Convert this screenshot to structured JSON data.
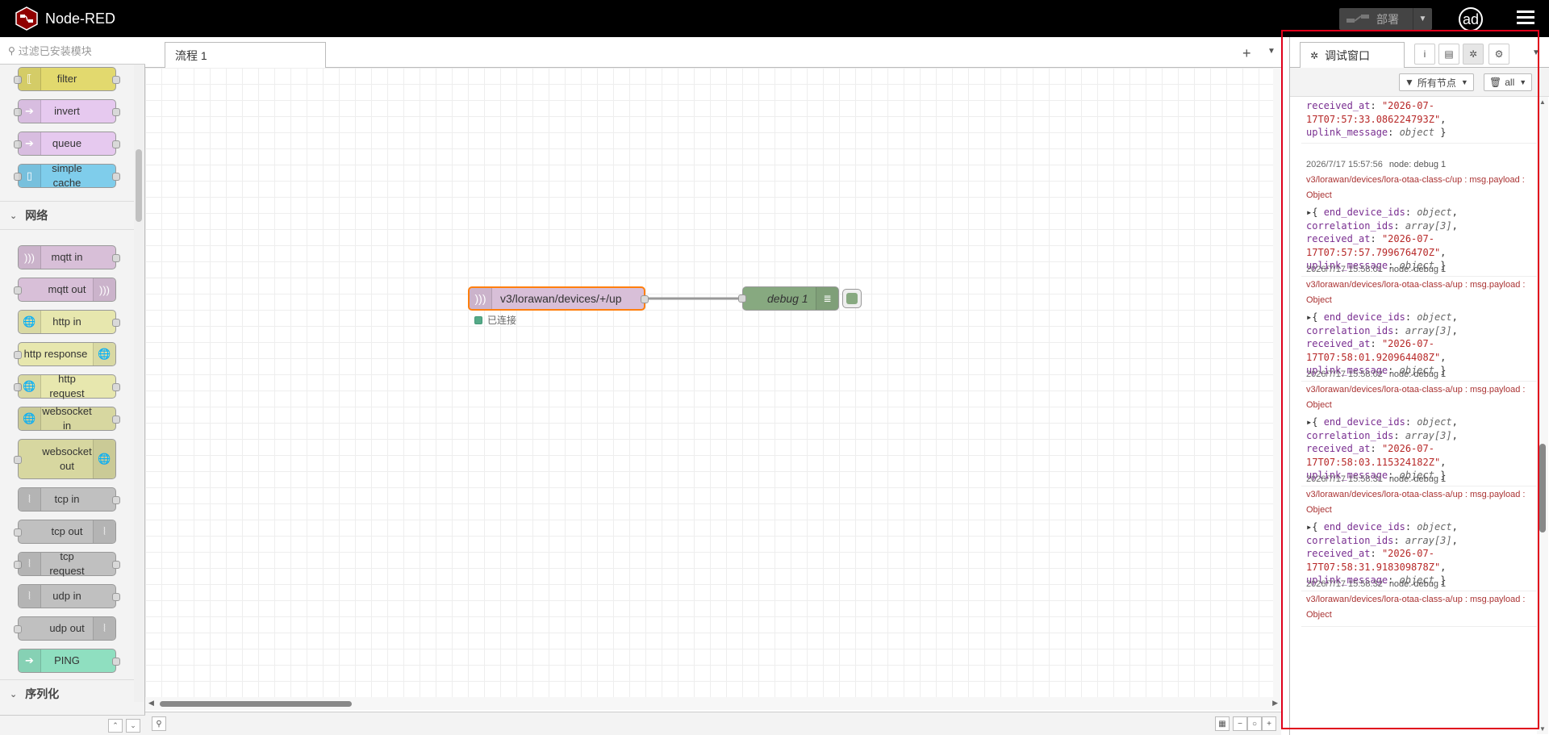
{
  "header": {
    "app_title": "Node-RED",
    "deploy_label": "部署",
    "user_initials": "ad"
  },
  "palette": {
    "search_placeholder": "过滤已安装模块",
    "nodes_top": [
      {
        "label": "filter",
        "color": "#e2d96e"
      },
      {
        "label": "invert",
        "color": "#e6c9ef"
      },
      {
        "label": "queue",
        "color": "#e6c9ef"
      },
      {
        "label": "simple cache",
        "color": "#7fcdeb"
      }
    ],
    "category_network": "网络",
    "nodes_network": [
      {
        "label": "mqtt in",
        "color": "#d8bfd8"
      },
      {
        "label": "mqtt out",
        "color": "#d8bfd8"
      },
      {
        "label": "http in",
        "color": "#e7e7ae"
      },
      {
        "label": "http response",
        "color": "#e7e7ae"
      },
      {
        "label": "http request",
        "color": "#e7e7ae"
      },
      {
        "label": "websocket in",
        "color": "#d7d7a0"
      },
      {
        "label": "websocket out",
        "color": "#d7d7a0"
      },
      {
        "label": "tcp in",
        "color": "#c0c0c0"
      },
      {
        "label": "tcp out",
        "color": "#c0c0c0"
      },
      {
        "label": "tcp request",
        "color": "#c0c0c0"
      },
      {
        "label": "udp in",
        "color": "#c0c0c0"
      },
      {
        "label": "udp out",
        "color": "#c0c0c0"
      },
      {
        "label": "PING",
        "color": "#8fdfc0"
      }
    ],
    "category_serialize": "序列化"
  },
  "workspace": {
    "tab_label": "流程 1",
    "mqtt_node_label": "v3/lorawan/devices/+/up",
    "mqtt_status": "已连接",
    "debug_node_label": "debug 1",
    "colors": {
      "mqtt": "#d8bfd8",
      "debug": "#87a980",
      "selected": "#ff7f0e",
      "status_ok": "#5a8"
    }
  },
  "sidebar": {
    "tab_label": "调试窗口",
    "filter_label": "所有节点",
    "clear_label": "all",
    "messages": [
      {
        "partial": true,
        "payload_lines": [
          [
            {
              "k": "received_at"
            },
            {
              "p": ": "
            },
            {
              "s": "\"2026-07-"
            }
          ],
          [
            {
              "s": "17T07:57:33.086224793Z\""
            },
            {
              "p": ","
            }
          ],
          [
            {
              "k": "uplink_message"
            },
            {
              "p": ": "
            },
            {
              "t": "object"
            },
            {
              "p": " }"
            }
          ]
        ]
      },
      {
        "time": "2026/7/17 15:57:56",
        "node": "node: debug 1",
        "topic": "v3/lorawan/devices/lora-otaa-class-c/up : msg.payload : Object",
        "payload_lines": [
          [
            {
              "p": "▸{ "
            },
            {
              "k": "end_device_ids"
            },
            {
              "p": ": "
            },
            {
              "t": "object"
            },
            {
              "p": ","
            }
          ],
          [
            {
              "k": "correlation_ids"
            },
            {
              "p": ": "
            },
            {
              "t": "array[3]"
            },
            {
              "p": ","
            }
          ],
          [
            {
              "k": "received_at"
            },
            {
              "p": ": "
            },
            {
              "s": "\"2026-07-"
            }
          ],
          [
            {
              "s": "17T07:57:57.799676470Z\""
            },
            {
              "p": ","
            }
          ],
          [
            {
              "k": "uplink_message"
            },
            {
              "p": ": "
            },
            {
              "t": "object"
            },
            {
              "p": " }"
            }
          ]
        ]
      },
      {
        "time": "2026/7/17 15:58:01",
        "node": "node: debug 1",
        "topic": "v3/lorawan/devices/lora-otaa-class-a/up : msg.payload : Object",
        "payload_lines": [
          [
            {
              "p": "▸{ "
            },
            {
              "k": "end_device_ids"
            },
            {
              "p": ": "
            },
            {
              "t": "object"
            },
            {
              "p": ","
            }
          ],
          [
            {
              "k": "correlation_ids"
            },
            {
              "p": ": "
            },
            {
              "t": "array[3]"
            },
            {
              "p": ","
            }
          ],
          [
            {
              "k": "received_at"
            },
            {
              "p": ": "
            },
            {
              "s": "\"2026-07-"
            }
          ],
          [
            {
              "s": "17T07:58:01.920964408Z\""
            },
            {
              "p": ","
            }
          ],
          [
            {
              "k": "uplink_message"
            },
            {
              "p": ": "
            },
            {
              "t": "object"
            },
            {
              "p": " }"
            }
          ]
        ]
      },
      {
        "time": "2026/7/17 15:58:02",
        "node": "node: debug 1",
        "topic": "v3/lorawan/devices/lora-otaa-class-a/up : msg.payload : Object",
        "payload_lines": [
          [
            {
              "p": "▸{ "
            },
            {
              "k": "end_device_ids"
            },
            {
              "p": ": "
            },
            {
              "t": "object"
            },
            {
              "p": ","
            }
          ],
          [
            {
              "k": "correlation_ids"
            },
            {
              "p": ": "
            },
            {
              "t": "array[3]"
            },
            {
              "p": ","
            }
          ],
          [
            {
              "k": "received_at"
            },
            {
              "p": ": "
            },
            {
              "s": "\"2026-07-"
            }
          ],
          [
            {
              "s": "17T07:58:03.115324182Z\""
            },
            {
              "p": ","
            }
          ],
          [
            {
              "k": "uplink_message"
            },
            {
              "p": ": "
            },
            {
              "t": "object"
            },
            {
              "p": " }"
            }
          ]
        ]
      },
      {
        "time": "2026/7/17 15:58:31",
        "node": "node: debug 1",
        "topic": "v3/lorawan/devices/lora-otaa-class-a/up : msg.payload : Object",
        "payload_lines": [
          [
            {
              "p": "▸{ "
            },
            {
              "k": "end_device_ids"
            },
            {
              "p": ": "
            },
            {
              "t": "object"
            },
            {
              "p": ","
            }
          ],
          [
            {
              "k": "correlation_ids"
            },
            {
              "p": ": "
            },
            {
              "t": "array[3]"
            },
            {
              "p": ","
            }
          ],
          [
            {
              "k": "received_at"
            },
            {
              "p": ": "
            },
            {
              "s": "\"2026-07-"
            }
          ],
          [
            {
              "s": "17T07:58:31.918309878Z\""
            },
            {
              "p": ","
            }
          ],
          [
            {
              "k": "uplink_message"
            },
            {
              "p": ": "
            },
            {
              "t": "object"
            },
            {
              "p": " }"
            }
          ]
        ]
      },
      {
        "time": "2026/7/17 15:58:32",
        "node": "node: debug 1",
        "topic": "v3/lorawan/devices/lora-otaa-class-a/up : msg.payload : Object",
        "payload_lines": []
      }
    ]
  }
}
